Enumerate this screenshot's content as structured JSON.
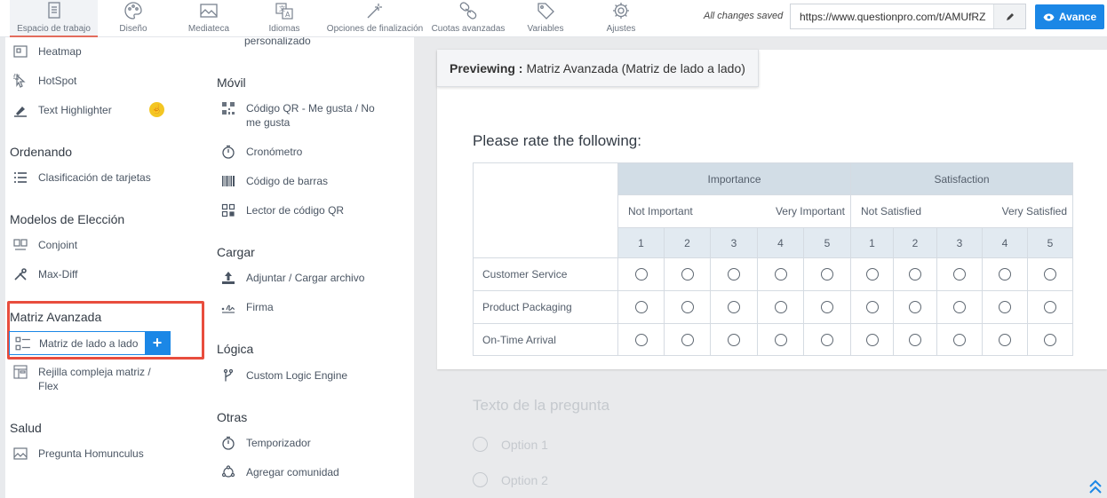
{
  "toolbar": {
    "tabs": [
      {
        "label": "Espacio de trabajo",
        "icon": "clipboard-icon"
      },
      {
        "label": "Diseño",
        "icon": "palette-icon"
      },
      {
        "label": "Mediateca",
        "icon": "image-icon"
      },
      {
        "label": "Idiomas",
        "icon": "translate-icon"
      },
      {
        "label": "Opciones de finalización",
        "icon": "magic-wand-icon"
      },
      {
        "label": "Cuotas avanzadas",
        "icon": "link-icon"
      },
      {
        "label": "Variables",
        "icon": "tag-icon"
      },
      {
        "label": "Ajustes",
        "icon": "gear-icon"
      }
    ],
    "saved_status": "All changes saved",
    "url": "https://www.questionpro.com/t/AMUfRZ",
    "preview_label": "Avance"
  },
  "left_panel": {
    "truncated_item": "personalizado",
    "col1": {
      "items_top": [
        "Heatmap",
        "HotSpot",
        "Text Highlighter"
      ],
      "sections": [
        {
          "title": "Ordenando",
          "items": [
            "Clasificación de tarjetas"
          ]
        },
        {
          "title": "Modelos de Elección",
          "items": [
            "Conjoint",
            "Max-Diff"
          ]
        },
        {
          "title": "Matriz Avanzada",
          "items": [
            "Matriz de lado a lado",
            "Rejilla compleja matriz / Flex"
          ]
        },
        {
          "title": "Salud",
          "items": [
            "Pregunta Homunculus"
          ]
        }
      ]
    },
    "col2": {
      "sections": [
        {
          "title": "Móvil",
          "items": [
            "Código QR - Me gusta / No me gusta",
            "Cronómetro",
            "Código de barras",
            "Lector de código QR"
          ]
        },
        {
          "title": "Cargar",
          "items": [
            "Adjuntar / Cargar archivo",
            "Firma"
          ]
        },
        {
          "title": "Lógica",
          "items": [
            "Custom Logic Engine"
          ]
        },
        {
          "title": "Otras",
          "items": [
            "Temporizador",
            "Agregar comunidad"
          ]
        }
      ]
    }
  },
  "preview": {
    "label": "Previewing :",
    "name": "Matriz Avanzada (Matriz de lado a lado)",
    "question": "Please rate the following:",
    "groups": [
      "Importance",
      "Satisfaction"
    ],
    "scale_labels": [
      [
        "Not Important",
        "Very Important"
      ],
      [
        "Not Satisfied",
        "Very Satisfied"
      ]
    ],
    "scale_numbers": [
      "1",
      "2",
      "3",
      "4",
      "5"
    ],
    "rows": [
      "Customer Service",
      "Product Packaging",
      "On-Time Arrival"
    ],
    "next_question": "Texto de la pregunta",
    "next_options": [
      "Option 1",
      "Option 2"
    ]
  },
  "colors": {
    "accent": "#1b87e6",
    "highlight": "#e84d3d",
    "header": "#d2dde6"
  }
}
